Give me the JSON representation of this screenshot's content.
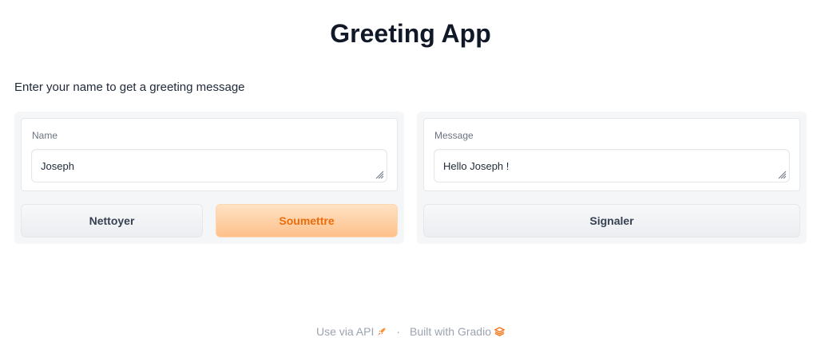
{
  "app": {
    "title": "Greeting App",
    "description": "Enter your name to get a greeting message"
  },
  "input_panel": {
    "field_label": "Name",
    "field_value": "Joseph",
    "clear_label": "Nettoyer",
    "submit_label": "Soumettre"
  },
  "output_panel": {
    "field_label": "Message",
    "field_value": "Hello Joseph !",
    "flag_label": "Signaler"
  },
  "footer": {
    "api_label": "Use via API",
    "api_icon": "rocket-icon",
    "separator": "·",
    "built_label": "Built with Gradio",
    "built_icon": "gradio-logo-icon"
  },
  "colors": {
    "primary_text": "#ea6c0a",
    "primary_bg": "#fdc08a",
    "panel_bg": "#f5f6f8"
  }
}
